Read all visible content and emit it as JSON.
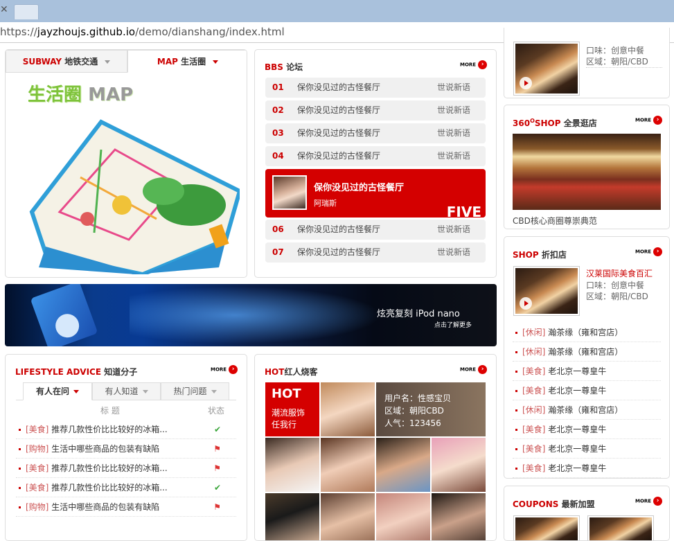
{
  "browser": {
    "url_scheme": "https://",
    "url_host": "jayzhoujs.github.io",
    "url_path": "/demo/dianshang/index.html"
  },
  "subway_tabs": [
    {
      "en": "SUBWAY",
      "zh": "地铁交通"
    },
    {
      "en": "MAP",
      "zh": "生活圈"
    }
  ],
  "map": {
    "title_zh": "生活圈",
    "title_en": "MAP"
  },
  "bbs": {
    "title_en": "BBS",
    "title_zh": "论坛",
    "more": "MORE",
    "rows_top": [
      {
        "num": "01",
        "title": "保你没见过的古怪餐厅",
        "author": "世说新语"
      },
      {
        "num": "02",
        "title": "保你没见过的古怪餐厅",
        "author": "世说新语"
      },
      {
        "num": "03",
        "title": "保你没见过的古怪餐厅",
        "author": "世说新语"
      },
      {
        "num": "04",
        "title": "保你没见过的古怪餐厅",
        "author": "世说新语"
      }
    ],
    "featured": {
      "title": "保你没见过的古怪餐厅",
      "author": "阿瑞斯",
      "rank": "FIVE"
    },
    "rows_bottom": [
      {
        "num": "06",
        "title": "保你没见过的古怪餐厅",
        "author": "世说新语"
      },
      {
        "num": "07",
        "title": "保你没见过的古怪餐厅",
        "author": "世说新语"
      }
    ]
  },
  "banner": {
    "text": "炫亮复刻  iPod nano",
    "sub": "点击了解更多"
  },
  "life": {
    "title_en": "LIFESTYLE ADVICE",
    "title_zh": "知道分子",
    "more": "MORE",
    "tabs": [
      "有人在问",
      "有人知道",
      "热门问题"
    ],
    "col_title": "标 题",
    "col_status": "状态",
    "rows": [
      {
        "cat": "[美食]",
        "text": "推荐几款性价比比较好的冰箱...",
        "status": "✔"
      },
      {
        "cat": "[购物]",
        "text": "生活中哪些商品的包装有缺陷",
        "status": "⚑"
      },
      {
        "cat": "[美食]",
        "text": "推荐几款性价比比较好的冰箱...",
        "status": "⚑"
      },
      {
        "cat": "[美食]",
        "text": "推荐几款性价比比较好的冰箱...",
        "status": "✔"
      },
      {
        "cat": "[购物]",
        "text": "生活中哪些商品的包装有缺陷",
        "status": "⚑"
      }
    ]
  },
  "hot": {
    "title_en": "HOT",
    "title_zh": "红人烧客",
    "more": "MORE",
    "badge": "HOT",
    "badge_text1": "潮流服饰",
    "badge_text2": "任我行",
    "profile_name": "用户名：性感宝贝",
    "profile_area": "区域：朝阳CBD",
    "profile_pop": "人气：123456"
  },
  "right_top": {
    "taste": "口味：创意中餐",
    "area": "区域：朝阳/CBD"
  },
  "shop360": {
    "title_num": "360",
    "title_sup": "O",
    "title_en": "SHOP",
    "title_zh": "全景逛店",
    "more": "MORE",
    "caption": "CBD核心商圈尊崇典范"
  },
  "shop": {
    "title_en": "SHOP",
    "title_zh": "折扣店",
    "more": "MORE",
    "featured_name": "汉莱国际美食百汇",
    "taste": "口味：创意中餐",
    "area": "区域：朝阳/CBD",
    "items": [
      {
        "cat": "[休闲]",
        "name": "瀚茶缘（雍和宫店）"
      },
      {
        "cat": "[休闲]",
        "name": "瀚茶缘（雍和宫店）"
      },
      {
        "cat": "[美食]",
        "name": "老北京一尊皇牛"
      },
      {
        "cat": "[美食]",
        "name": "老北京一尊皇牛"
      },
      {
        "cat": "[休闲]",
        "name": "瀚茶缘（雍和宫店）"
      },
      {
        "cat": "[美食]",
        "name": "老北京一尊皇牛"
      },
      {
        "cat": "[美食]",
        "name": "老北京一尊皇牛"
      },
      {
        "cat": "[美食]",
        "name": "老北京一尊皇牛"
      }
    ]
  },
  "coupons": {
    "title_en": "COUPONS",
    "title_zh": "最新加盟",
    "more": "MORE"
  }
}
